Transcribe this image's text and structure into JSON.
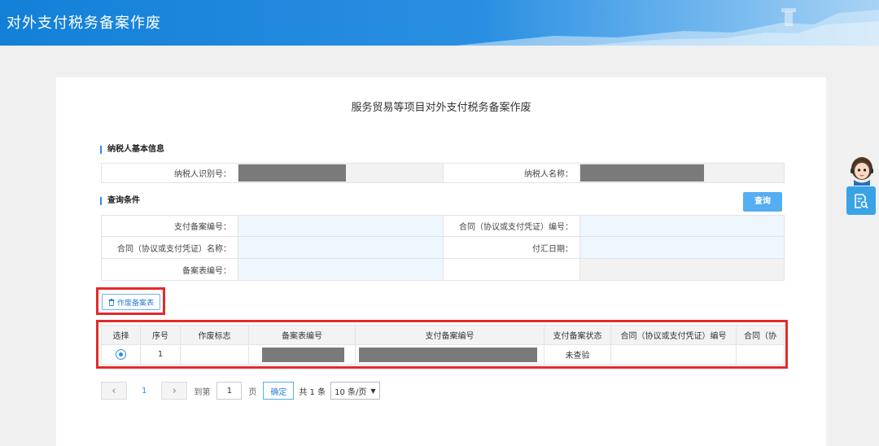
{
  "app": {
    "title": "对外支付税务备案作废"
  },
  "page": {
    "title": "服务贸易等项目对外支付税务备案作废"
  },
  "taxpayer": {
    "section_title": "纳税人基本信息",
    "id_label": "纳税人识别号：",
    "name_label": "纳税人名称："
  },
  "query": {
    "section_title": "查询条件",
    "button": "查询",
    "payment_no_label": "支付备案编号：",
    "contract_no_label": "合同（协议或支付凭证）编号：",
    "contract_name_label": "合同（协议或支付凭证）名称：",
    "remit_date_label": "付汇日期：",
    "form_no_label": "备案表编号："
  },
  "actions": {
    "void_button": "作废备案表"
  },
  "table": {
    "columns": [
      "选择",
      "序号",
      "作废标志",
      "备案表编号",
      "支付备案编号",
      "支付备案状态",
      "合同（协议或支付凭证）编号",
      "合同（协"
    ],
    "rows": [
      {
        "index": "1",
        "status": "未查验"
      }
    ]
  },
  "pager": {
    "current_page": "1",
    "goto_prefix": "到第",
    "goto_value": "1",
    "goto_suffix": "页",
    "confirm": "确定",
    "total": "共 1 条",
    "page_size": "10 条/页",
    "prev_icon": "‹",
    "next_icon": "›"
  },
  "colors": {
    "accent": "#2b8de6",
    "highlight": "#e22b2b",
    "header_blue": "#1380d8"
  }
}
